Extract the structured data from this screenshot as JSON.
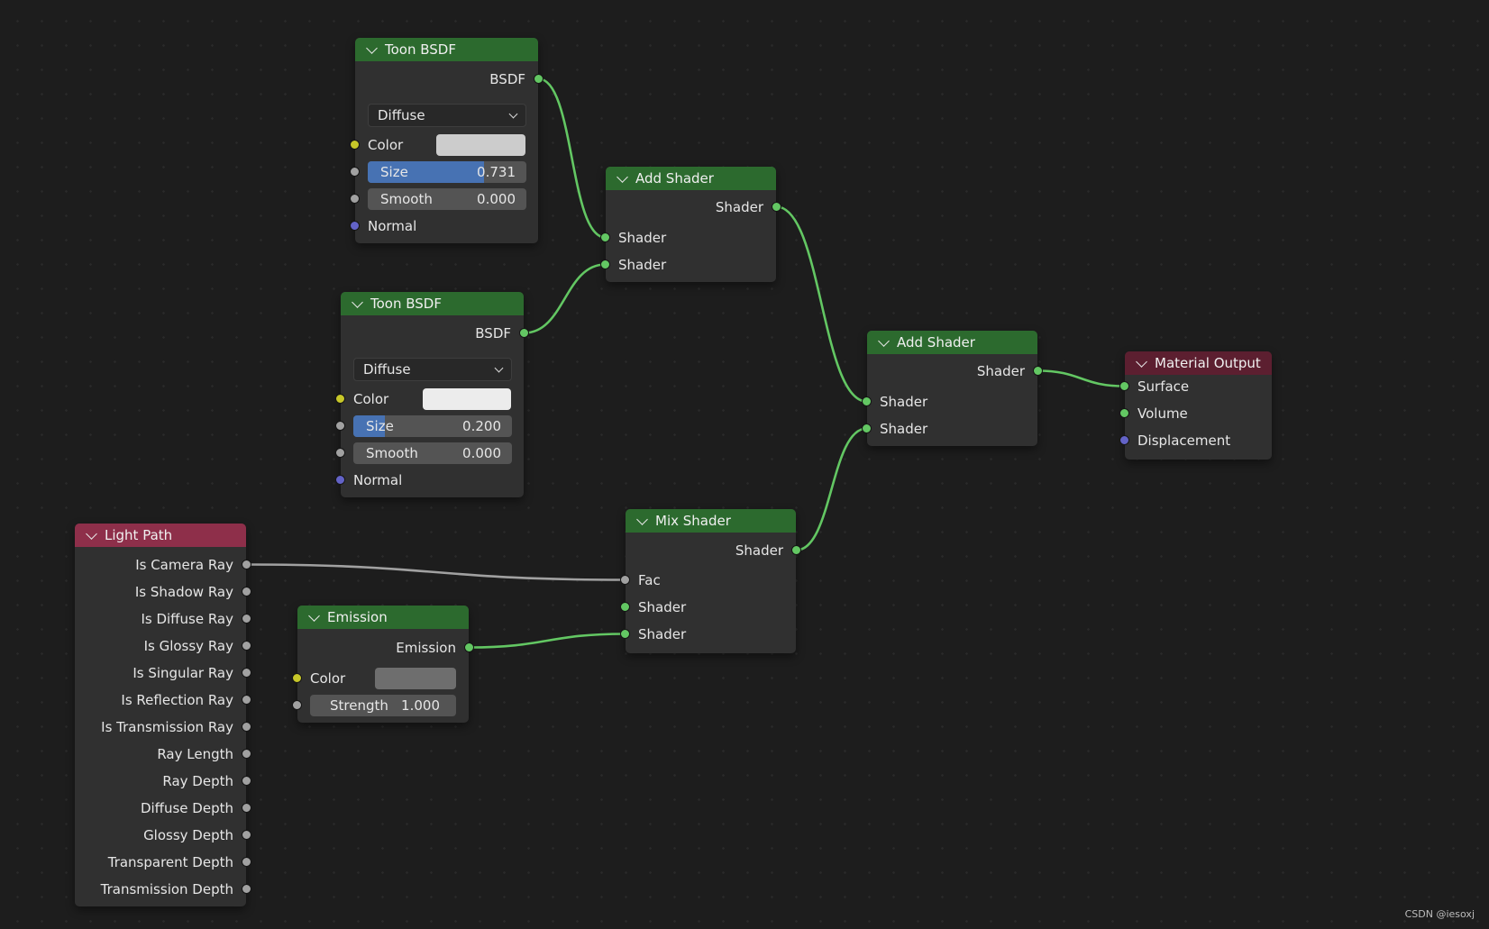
{
  "nodes": {
    "toon1": {
      "title": "Toon BSDF",
      "output": "BSDF",
      "component": "Diffuse",
      "color_label": "Color",
      "color_value": "#cccccc",
      "size_label": "Size",
      "size_value": "0.731",
      "size_fraction": 0.731,
      "smooth_label": "Smooth",
      "smooth_value": "0.000",
      "normal_label": "Normal"
    },
    "toon2": {
      "title": "Toon BSDF",
      "output": "BSDF",
      "component": "Diffuse",
      "color_label": "Color",
      "color_value": "#ececec",
      "size_label": "Size",
      "size_value": "0.200",
      "size_fraction": 0.2,
      "smooth_label": "Smooth",
      "smooth_value": "0.000",
      "normal_label": "Normal"
    },
    "add1": {
      "title": "Add Shader",
      "output": "Shader",
      "input1": "Shader",
      "input2": "Shader"
    },
    "add2": {
      "title": "Add Shader",
      "output": "Shader",
      "input1": "Shader",
      "input2": "Shader"
    },
    "material_output": {
      "title": "Material Output",
      "surface": "Surface",
      "volume": "Volume",
      "displacement": "Displacement"
    },
    "mix": {
      "title": "Mix Shader",
      "output": "Shader",
      "fac": "Fac",
      "input1": "Shader",
      "input2": "Shader"
    },
    "emission": {
      "title": "Emission",
      "output": "Emission",
      "color_label": "Color",
      "color_value": "#6e6e6e",
      "strength_label": "Strength",
      "strength_value": "1.000"
    },
    "light_path": {
      "title": "Light Path",
      "outputs": [
        "Is Camera Ray",
        "Is Shadow Ray",
        "Is Diffuse Ray",
        "Is Glossy Ray",
        "Is Singular Ray",
        "Is Reflection Ray",
        "Is Transmission Ray",
        "Ray Length",
        "Ray Depth",
        "Diffuse Depth",
        "Glossy Depth",
        "Transparent Depth",
        "Transmission Depth"
      ]
    }
  },
  "colors": {
    "shader_socket": "#63c763",
    "float_socket": "#a1a1a1",
    "color_socket": "#c7c729",
    "vector_socket": "#6363c7",
    "shader_wire": "#63c763",
    "float_wire": "#a1a1a1",
    "slider_fill": "#4772b3"
  },
  "watermark": "CSDN @iesoxj"
}
